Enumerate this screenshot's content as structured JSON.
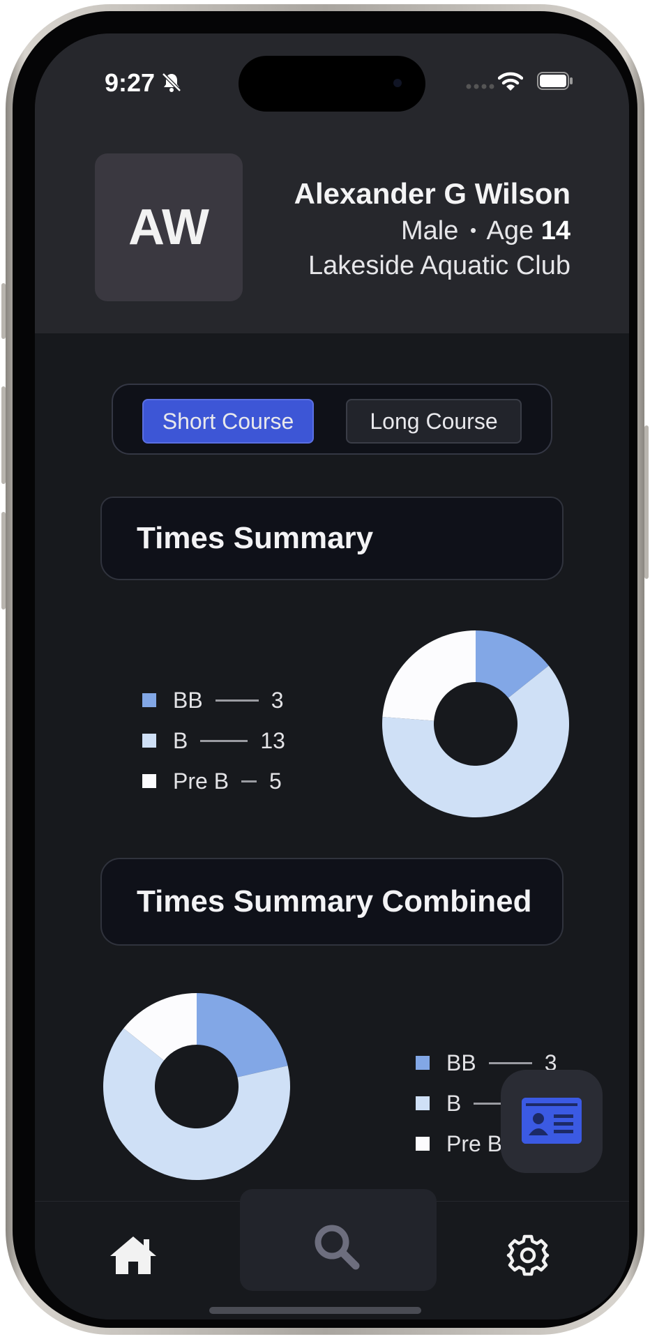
{
  "status": {
    "time": "9:27"
  },
  "profile": {
    "initials": "AW",
    "name": "Alexander G Wilson",
    "gender": "Male",
    "age_label": "Age",
    "age": "14",
    "club": "Lakeside Aquatic Club"
  },
  "course_toggle": {
    "options": [
      "Short Course",
      "Long Course"
    ],
    "selected": "Short Course"
  },
  "sections": [
    {
      "title": "Times Summary",
      "legend": [
        {
          "label": "BB",
          "value": "3",
          "color": "#82a7e6"
        },
        {
          "label": "B",
          "value": "13",
          "color": "#cfe0f6"
        },
        {
          "label": "Pre B",
          "value": "5",
          "color": "#fcfcfe"
        }
      ],
      "chart_data": {
        "type": "pie",
        "values": [
          3,
          13,
          5
        ],
        "categories": [
          "BB",
          "B",
          "Pre B"
        ]
      }
    },
    {
      "title": "Times Summary Combined",
      "legend": [
        {
          "label": "BB",
          "value": "3",
          "color": "#82a7e6"
        },
        {
          "label": "B",
          "value": "",
          "color": "#cfe0f6"
        },
        {
          "label": "Pre B",
          "value": "",
          "color": "#fcfcfe"
        }
      ],
      "chart_data": {
        "type": "pie",
        "values": [
          3,
          9,
          2
        ],
        "categories": [
          "BB",
          "B",
          "Pre B"
        ]
      }
    }
  ],
  "icons": {
    "fab": "id-card-icon",
    "tabs": [
      "home-icon",
      "search-icon",
      "gear-icon"
    ]
  },
  "colors": {
    "accent": "#3d56d6",
    "background": "#17191d",
    "header": "#26272c"
  }
}
